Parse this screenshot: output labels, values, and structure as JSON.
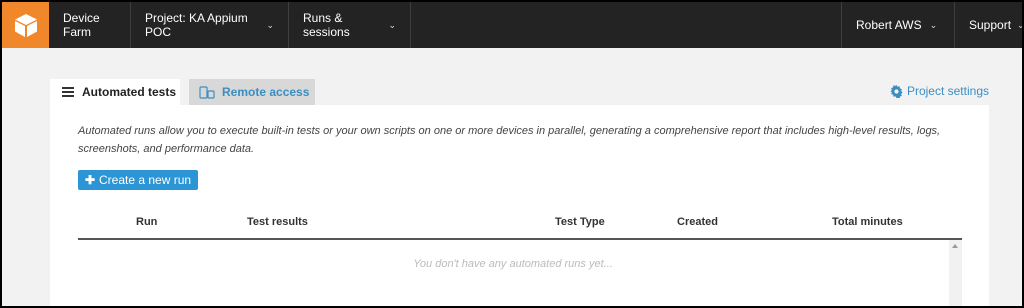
{
  "nav": {
    "brand": "Device Farm",
    "project": "Project: KA Appium POC",
    "runs": "Runs & sessions",
    "user": "Robert AWS",
    "support": "Support",
    "logo_color": "#f0882b"
  },
  "tabs": {
    "automated": "Automated tests",
    "remote": "Remote access"
  },
  "settings_link": "Project settings",
  "description": "Automated runs allow you to execute built-in tests or your own scripts on one or more devices in parallel, generating a comprehensive report that includes high-level results, logs, screenshots, and performance data.",
  "create_button": "Create a new run",
  "table": {
    "columns": [
      "Run",
      "Test results",
      "Test Type",
      "Created",
      "Total minutes"
    ],
    "empty_message": "You don't have any automated runs yet..."
  },
  "colors": {
    "accent": "#2b95d6",
    "link": "#3b8ec2",
    "nav_bg": "#232323"
  },
  "icons": {
    "caret": "chevron-down-icon",
    "settings": "gear-icon"
  }
}
